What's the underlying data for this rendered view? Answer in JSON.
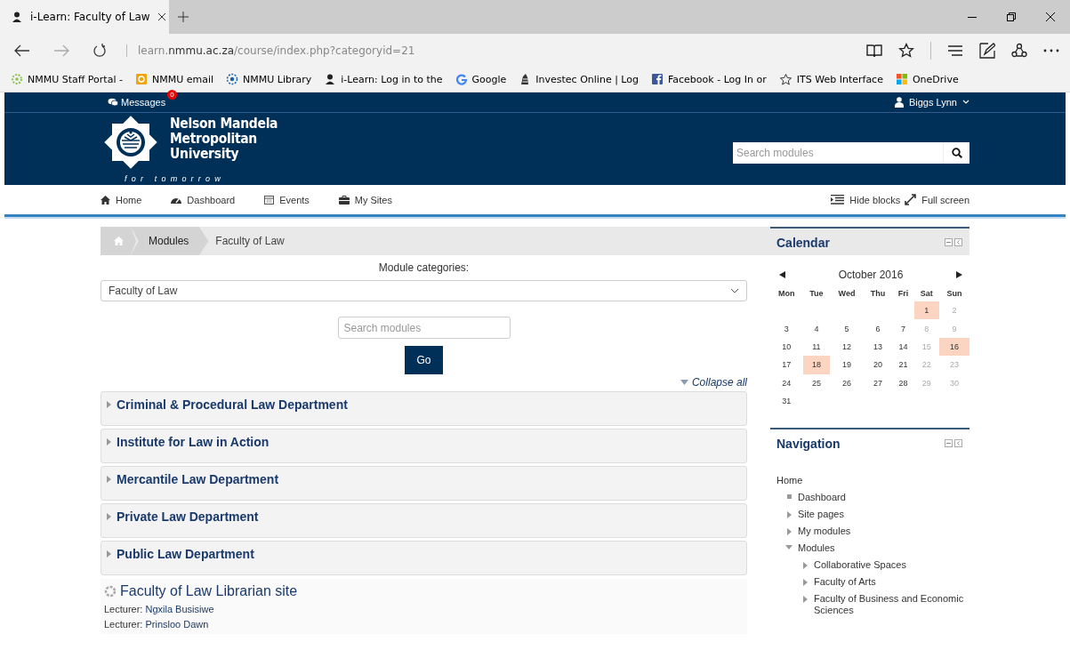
{
  "browser": {
    "tab": {
      "title": "i-Learn: Faculty of Law"
    },
    "url": {
      "subdomain": "learn.",
      "domain": "nmmu.ac.za",
      "path": "/course/index.php?categoryid=21"
    },
    "bookmarks": [
      "NMMU Staff Portal -",
      "NMMU email",
      "NMMU Library",
      "i-Learn: Log in to the",
      "Google",
      "Investec Online | Log",
      "Facebook - Log In or",
      "ITS Web Interface",
      "OneDrive"
    ]
  },
  "header": {
    "messages": {
      "label": "Messages",
      "count": "0"
    },
    "user": "Biggs Lynn",
    "logo": {
      "lines": [
        "Nelson Mandela",
        "Metropolitan",
        "University"
      ],
      "tagline": "for tomorrow"
    },
    "search": {
      "placeholder": "Search modules"
    }
  },
  "navbar": {
    "items": [
      "Home",
      "Dashboard",
      "Events",
      "My Sites"
    ],
    "actions": [
      "Hide blocks",
      "Full screen"
    ]
  },
  "breadcrumb": [
    "Modules",
    "Faculty of Law"
  ],
  "categories": {
    "label": "Module categories:",
    "value": "Faculty of Law",
    "search": {
      "placeholder": "Search modules"
    },
    "go": "Go",
    "collapse_all": "Collapse all",
    "items": [
      {
        "name": "Criminal & Procedural Law Department",
        "expanded": false
      },
      {
        "name": "Institute for Law in Action",
        "expanded": false
      },
      {
        "name": "Mercantile Law Department",
        "expanded": false
      },
      {
        "name": "Private Law Department",
        "expanded": false
      },
      {
        "name": "Public Law Department",
        "expanded": false
      }
    ]
  },
  "course": {
    "name": "Faculty of Law Librarian site",
    "teachers": [
      {
        "role": "Lecturer:",
        "name": "Ngxila Busisiwe"
      },
      {
        "role": "Lecturer:",
        "name": "Prinsloo Dawn"
      }
    ]
  },
  "calendar": {
    "title": "Calendar",
    "month": "October 2016",
    "weekdays": [
      "Mon",
      "Tue",
      "Wed",
      "Thu",
      "Fri",
      "Sat",
      "Sun"
    ],
    "weeks": [
      [
        {
          "day": "1",
          "event": true
        },
        {
          "day": "2",
          "event": false
        }
      ],
      [
        {
          "day": "3",
          "event": false
        },
        {
          "day": "4",
          "event": false
        },
        {
          "day": "5",
          "event": false
        },
        {
          "day": "6",
          "event": false
        },
        {
          "day": "7",
          "event": false
        },
        {
          "day": "8",
          "event": false
        },
        {
          "day": "9",
          "event": false
        }
      ],
      [
        {
          "day": "10",
          "event": false
        },
        {
          "day": "11",
          "event": false
        },
        {
          "day": "12",
          "event": false
        },
        {
          "day": "13",
          "event": false
        },
        {
          "day": "14",
          "event": false
        },
        {
          "day": "15",
          "event": false
        },
        {
          "day": "16",
          "event": true
        }
      ],
      [
        {
          "day": "17",
          "event": false
        },
        {
          "day": "18",
          "event": true
        },
        {
          "day": "19",
          "event": false
        },
        {
          "day": "20",
          "event": false
        },
        {
          "day": "21",
          "event": false
        },
        {
          "day": "22",
          "event": false
        },
        {
          "day": "23",
          "event": false
        }
      ],
      [
        {
          "day": "24",
          "event": false
        },
        {
          "day": "25",
          "event": false
        },
        {
          "day": "26",
          "event": false
        },
        {
          "day": "27",
          "event": false
        },
        {
          "day": "28",
          "event": false
        },
        {
          "day": "29",
          "event": false
        },
        {
          "day": "30",
          "event": false
        }
      ],
      [
        {
          "day": "31",
          "event": false
        }
      ]
    ]
  },
  "navigation": {
    "title": "Navigation",
    "tree": [
      {
        "label": "Home",
        "kind": "root",
        "children": [
          {
            "label": "Dashboard",
            "kind": "leaf"
          },
          {
            "label": "Site pages",
            "kind": "branch",
            "expanded": false
          },
          {
            "label": "My modules",
            "kind": "branch",
            "expanded": false
          },
          {
            "label": "Modules",
            "kind": "branch",
            "expanded": true,
            "children": [
              {
                "label": "Collaborative Spaces",
                "kind": "branch",
                "expanded": false
              },
              {
                "label": "Faculty of Arts",
                "kind": "branch",
                "expanded": false
              },
              {
                "label": "Faculty of Business and Economic Sciences",
                "kind": "branch",
                "expanded": false
              }
            ]
          }
        ]
      }
    ]
  }
}
